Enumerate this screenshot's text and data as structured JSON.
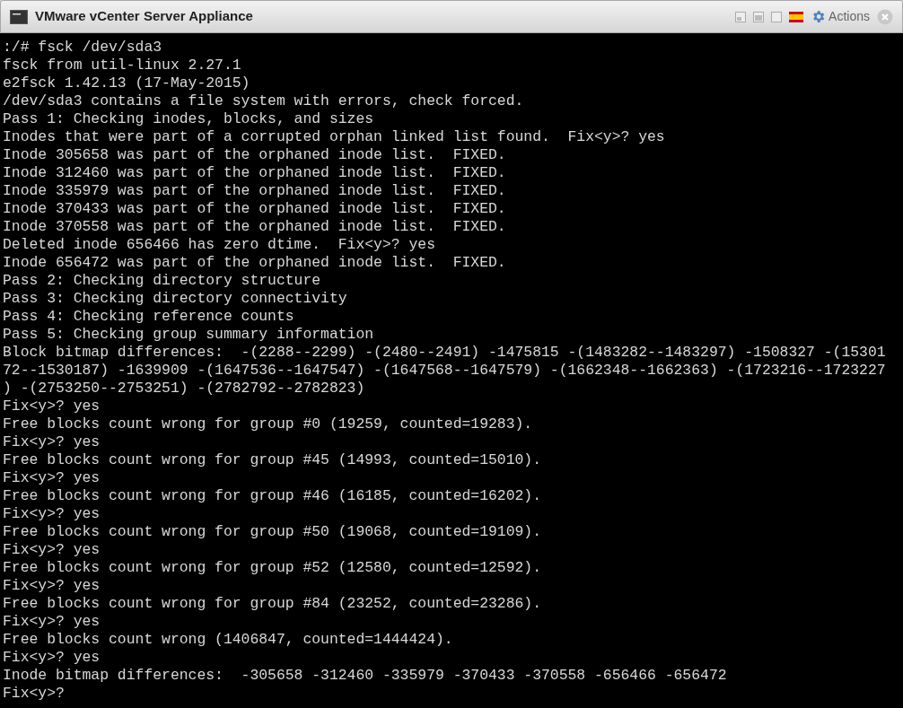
{
  "window": {
    "title": "VMware vCenter Server Appliance",
    "actions_label": "Actions"
  },
  "terminal": {
    "lines": [
      ":/# fsck /dev/sda3",
      "fsck from util-linux 2.27.1",
      "e2fsck 1.42.13 (17-May-2015)",
      "/dev/sda3 contains a file system with errors, check forced.",
      "Pass 1: Checking inodes, blocks, and sizes",
      "Inodes that were part of a corrupted orphan linked list found.  Fix<y>? yes",
      "Inode 305658 was part of the orphaned inode list.  FIXED.",
      "Inode 312460 was part of the orphaned inode list.  FIXED.",
      "Inode 335979 was part of the orphaned inode list.  FIXED.",
      "Inode 370433 was part of the orphaned inode list.  FIXED.",
      "Inode 370558 was part of the orphaned inode list.  FIXED.",
      "Deleted inode 656466 has zero dtime.  Fix<y>? yes",
      "Inode 656472 was part of the orphaned inode list.  FIXED.",
      "Pass 2: Checking directory structure",
      "Pass 3: Checking directory connectivity",
      "Pass 4: Checking reference counts",
      "Pass 5: Checking group summary information",
      "Block bitmap differences:  -(2288--2299) -(2480--2491) -1475815 -(1483282--1483297) -1508327 -(15301",
      "72--1530187) -1639909 -(1647536--1647547) -(1647568--1647579) -(1662348--1662363) -(1723216--1723227",
      ") -(2753250--2753251) -(2782792--2782823)",
      "Fix<y>? yes",
      "Free blocks count wrong for group #0 (19259, counted=19283).",
      "Fix<y>? yes",
      "Free blocks count wrong for group #45 (14993, counted=15010).",
      "Fix<y>? yes",
      "Free blocks count wrong for group #46 (16185, counted=16202).",
      "Fix<y>? yes",
      "Free blocks count wrong for group #50 (19068, counted=19109).",
      "Fix<y>? yes",
      "Free blocks count wrong for group #52 (12580, counted=12592).",
      "Fix<y>? yes",
      "Free blocks count wrong for group #84 (23252, counted=23286).",
      "Fix<y>? yes",
      "Free blocks count wrong (1406847, counted=1444424).",
      "Fix<y>? yes",
      "Inode bitmap differences:  -305658 -312460 -335979 -370433 -370558 -656466 -656472",
      "Fix<y>?"
    ]
  }
}
